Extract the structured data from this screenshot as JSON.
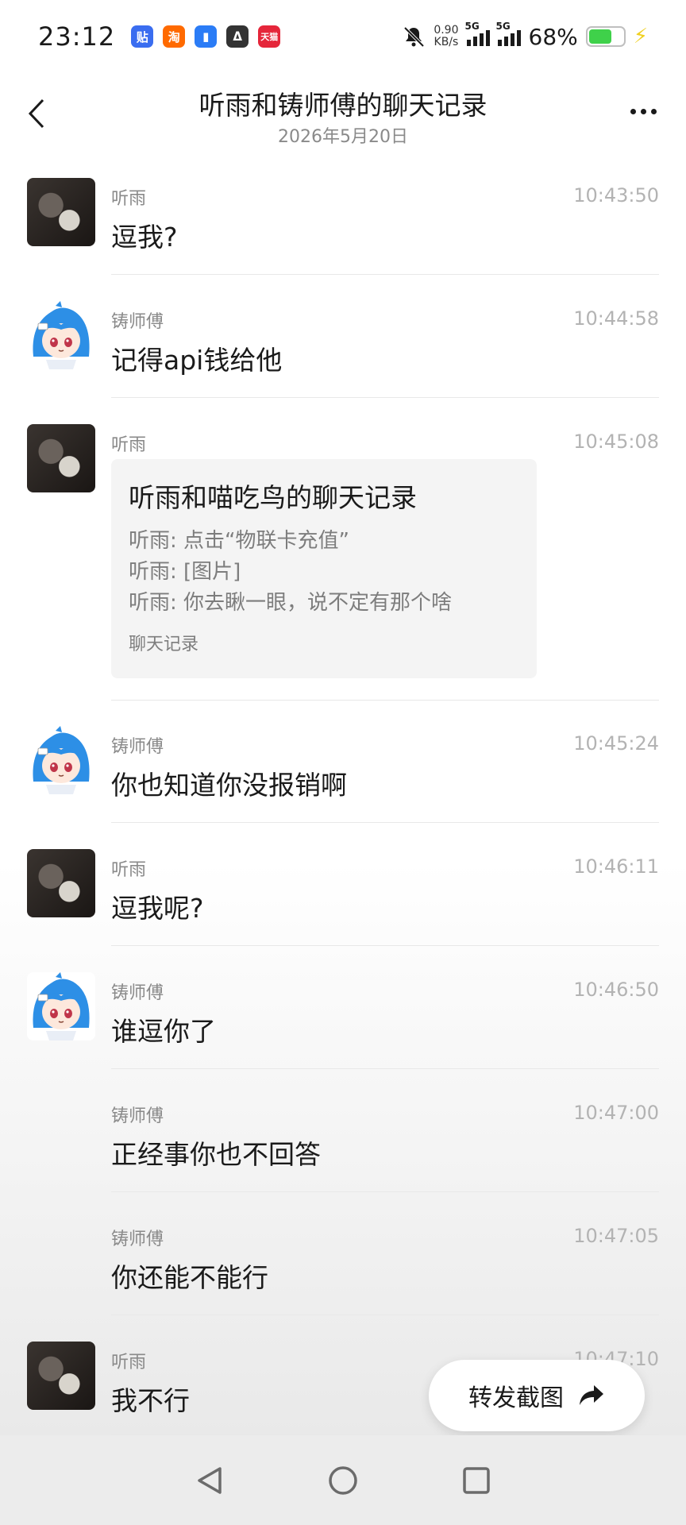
{
  "status_bar": {
    "time": "23:12",
    "net_speed_value": "0.90",
    "net_speed_unit": "KB/s",
    "signal1_tag": "5G",
    "signal2_tag": "5G",
    "battery": "68%",
    "battery_level": 0.68,
    "notification_icons": [
      {
        "name": "tieba-app-icon",
        "glyph": "贴",
        "color": "#3a6df0"
      },
      {
        "name": "taobao-app-icon",
        "glyph": "淘",
        "color": "#ff6a00"
      },
      {
        "name": "chat-app-icon",
        "glyph": "▮",
        "color": "#2b7cf6"
      },
      {
        "name": "link-app-icon",
        "glyph": "ᐃ",
        "color": "#333333"
      },
      {
        "name": "tmall-app-icon",
        "glyph": "天猫",
        "color": "#e5263a"
      }
    ]
  },
  "header": {
    "title": "听雨和铸师傅的聊天记录",
    "subtitle": "2026年5月20日"
  },
  "messages": [
    {
      "sender": "听雨",
      "time": "10:43:50",
      "text": "逗我?",
      "avatar": "user"
    },
    {
      "sender": "铸师傅",
      "time": "10:44:58",
      "text": "记得api钱给他",
      "avatar": "bot"
    },
    {
      "sender": "听雨",
      "time": "10:45:08",
      "avatar": "user",
      "card": {
        "title": "听雨和喵吃鸟的聊天记录",
        "lines": [
          "听雨: 点击“物联卡充值”",
          "听雨: [图片]",
          "听雨: 你去瞅一眼，说不定有那个啥"
        ],
        "footer": "聊天记录"
      }
    },
    {
      "sender": "铸师傅",
      "time": "10:45:24",
      "text": "你也知道你没报销啊",
      "avatar": "bot"
    },
    {
      "sender": "听雨",
      "time": "10:46:11",
      "text": "逗我呢?",
      "avatar": "user"
    },
    {
      "sender": "铸师傅",
      "time": "10:46:50",
      "text": "谁逗你了",
      "avatar": "bot"
    },
    {
      "sender": "铸师傅",
      "time": "10:47:00",
      "text": "正经事你也不回答",
      "avatar": "none"
    },
    {
      "sender": "铸师傅",
      "time": "10:47:05",
      "text": "你还能不能行",
      "avatar": "none"
    },
    {
      "sender": "听雨",
      "time": "10:47:10",
      "text": "我不行",
      "avatar": "user"
    }
  ],
  "forward_button": {
    "label": "转发截图",
    "icon": "share-arrow-icon"
  },
  "nav_bar": {
    "back": "nav-back-icon",
    "home": "nav-home-icon",
    "recents": "nav-recents-icon"
  },
  "colors": {
    "battery_fill": "#3fd14a",
    "charging_bolt": "#f0d020",
    "secondary_text": "#8a8a8a",
    "timestamp": "#b3b3b3",
    "card_bg": "#f4f4f4"
  }
}
